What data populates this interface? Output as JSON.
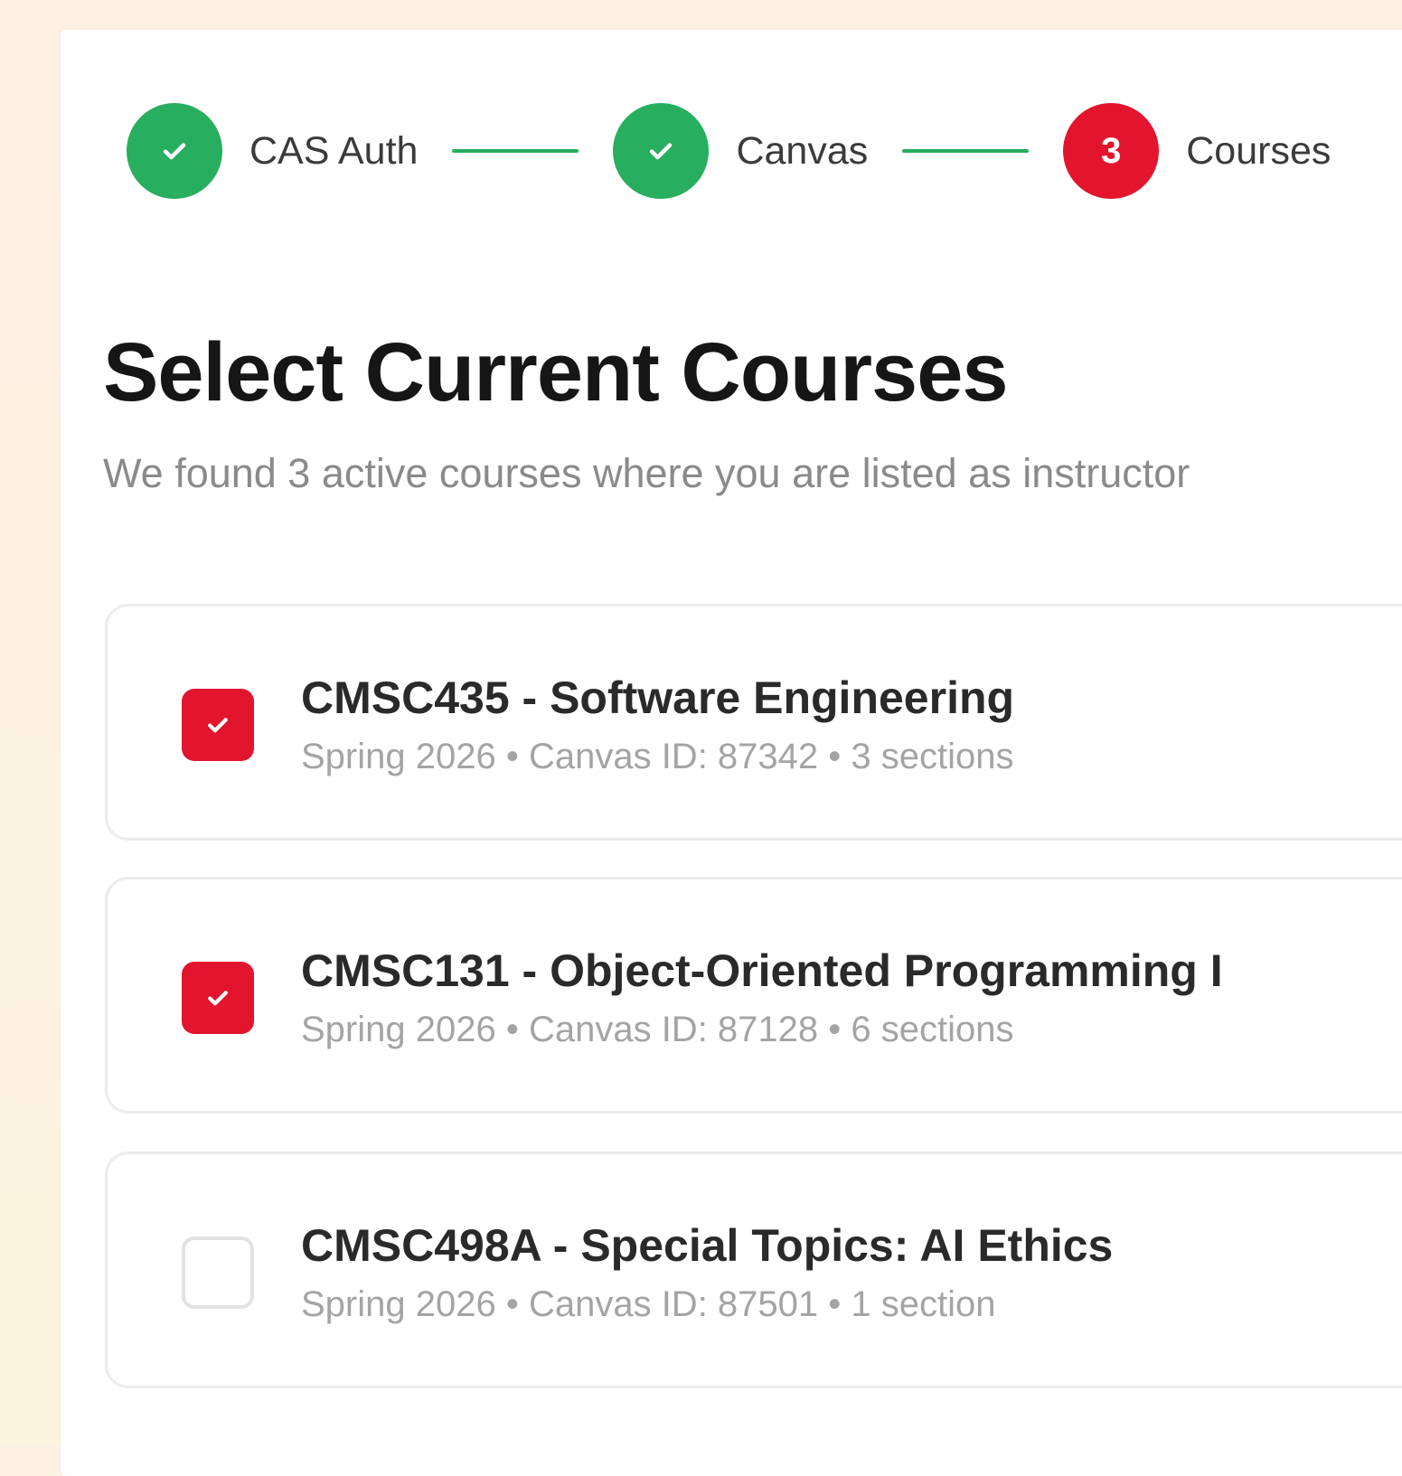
{
  "stepper": {
    "steps": [
      {
        "label": "CAS Auth",
        "status": "done",
        "icon": "check-icon"
      },
      {
        "label": "Canvas",
        "status": "done",
        "icon": "check-icon"
      },
      {
        "label": "Courses",
        "status": "active",
        "number": "3"
      }
    ]
  },
  "page": {
    "title": "Select Current Courses",
    "subtitle": "We found 3 active courses where you are listed as instructor"
  },
  "courses": [
    {
      "title": "CMSC435 - Software Engineering",
      "meta": "Spring 2026 • Canvas ID: 87342 • 3 sections",
      "checked": true
    },
    {
      "title": "CMSC131 - Object-Oriented Programming I",
      "meta": "Spring 2026 • Canvas ID: 87128 • 6 sections",
      "checked": true
    },
    {
      "title": "CMSC498A - Special Topics: AI Ethics",
      "meta": "Spring 2026 • Canvas ID: 87501 • 1 section",
      "checked": false
    }
  ],
  "colors": {
    "done": "#27ae5f",
    "active": "#e3142d",
    "background": "#fdf2e2"
  }
}
